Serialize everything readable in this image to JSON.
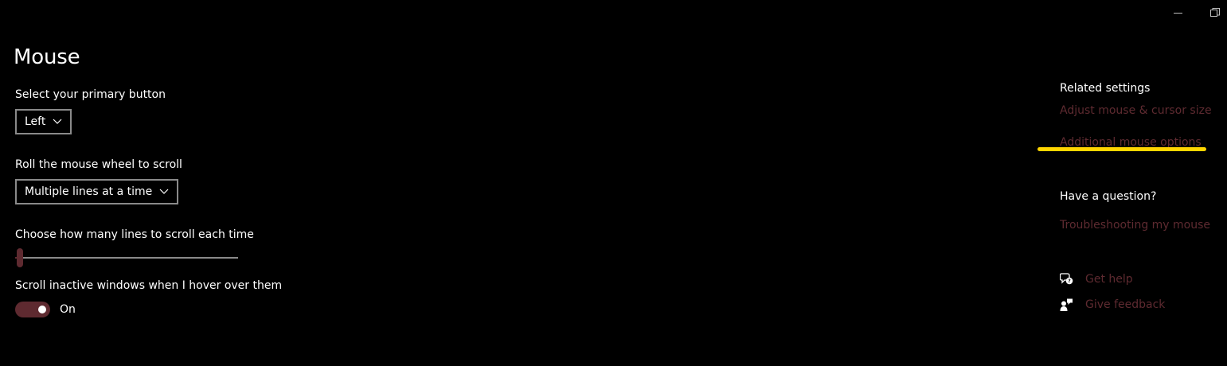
{
  "window": {
    "minimize_icon": "minimize-icon",
    "restore_icon": "restore-icon"
  },
  "page": {
    "title": "Mouse"
  },
  "primary_button": {
    "label": "Select your primary button",
    "selected": "Left"
  },
  "wheel_scroll": {
    "label": "Roll the mouse wheel to scroll",
    "selected": "Multiple lines at a time"
  },
  "lines_to_scroll": {
    "label": "Choose how many lines to scroll each time",
    "value": 3,
    "min": 1,
    "max": 100
  },
  "inactive_scroll": {
    "label": "Scroll inactive windows when I hover over them",
    "state": "On"
  },
  "related_settings": {
    "heading": "Related settings",
    "links": [
      "Adjust mouse & cursor size",
      "Additional mouse options"
    ]
  },
  "question": {
    "heading": "Have a question?",
    "link": "Troubleshooting my mouse"
  },
  "help": {
    "get_help": "Get help",
    "give_feedback": "Give feedback"
  },
  "colors": {
    "accent": "#5e2a30",
    "highlight": "#ffd500",
    "background": "#000000"
  }
}
